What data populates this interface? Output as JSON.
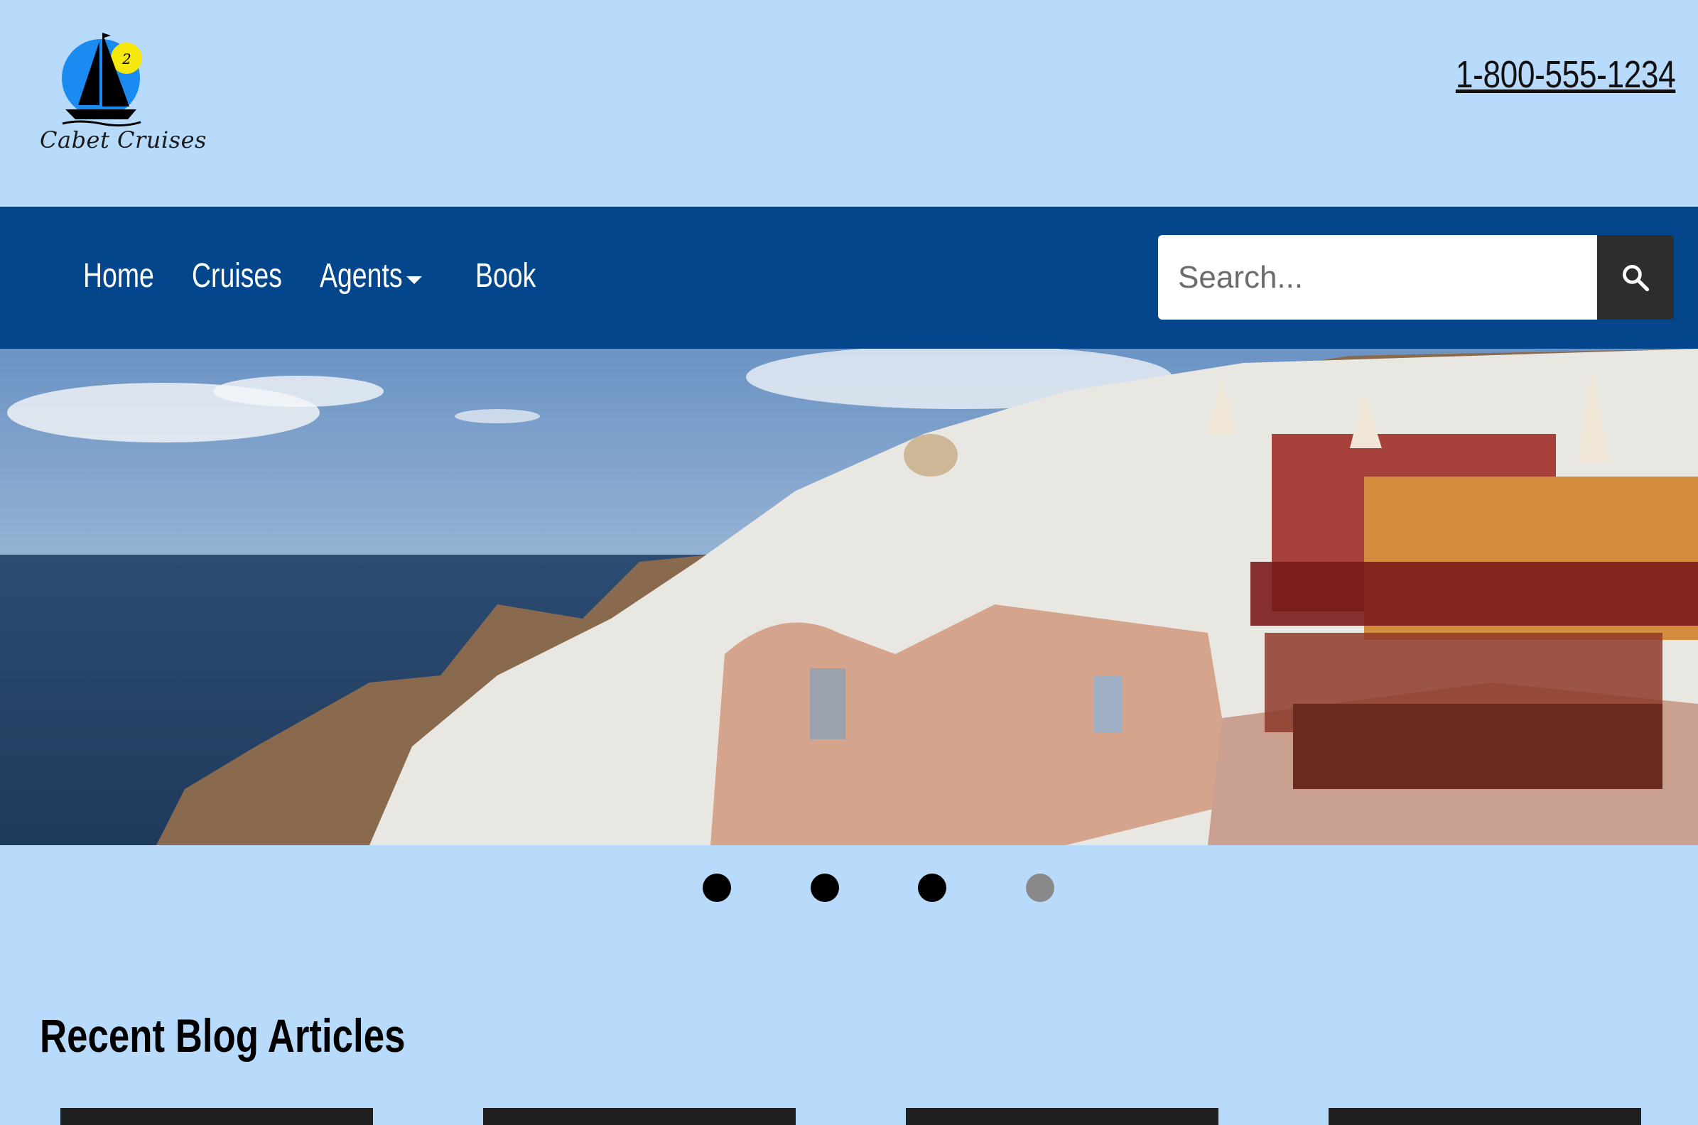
{
  "brand": {
    "name": "Cabet Cruises",
    "badge": "2",
    "logo_icon": "sailboat-icon"
  },
  "header": {
    "phone": "1-800-555-1234"
  },
  "nav": {
    "items": [
      {
        "label": "Home"
      },
      {
        "label": "Cruises"
      },
      {
        "label": "Agents",
        "has_dropdown": true
      },
      {
        "label": "Book"
      }
    ],
    "search": {
      "placeholder": "Search...",
      "value": "",
      "icon": "search-icon"
    }
  },
  "hero": {
    "description_icon": "photo",
    "carousel": {
      "slides": 4,
      "active_index": 3
    }
  },
  "blog": {
    "title": "Recent Blog Articles",
    "cards": 4
  },
  "colors": {
    "page_bg": "#b8dafb",
    "nav_bg": "#03468b",
    "search_button": "#2d2d2d",
    "dot": "#000000",
    "dot_active": "#8a8a8a"
  }
}
